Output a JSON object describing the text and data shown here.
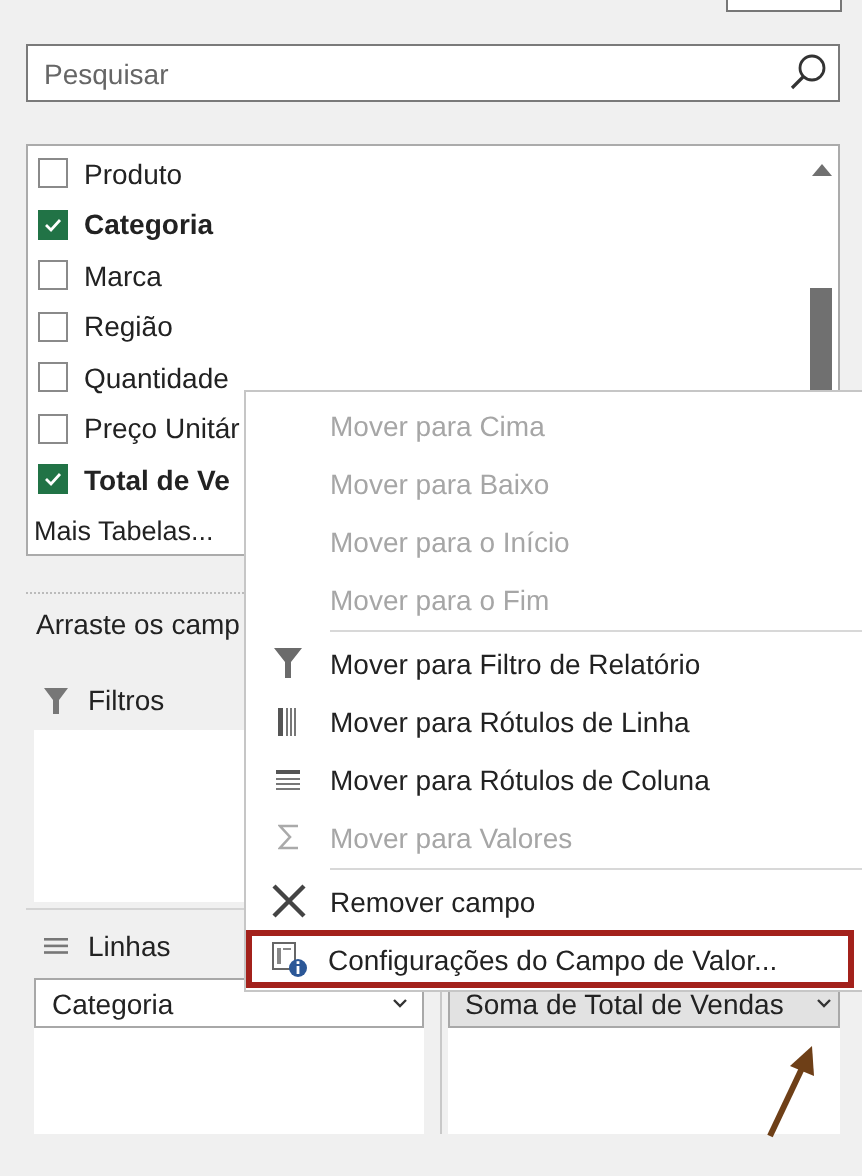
{
  "search": {
    "placeholder": "Pesquisar"
  },
  "fields": [
    {
      "label": "Produto",
      "checked": false
    },
    {
      "label": "Categoria",
      "checked": true
    },
    {
      "label": "Marca",
      "checked": false
    },
    {
      "label": "Região",
      "checked": false
    },
    {
      "label": "Quantidade",
      "checked": false
    },
    {
      "label": "Preço Unitár",
      "checked": false
    },
    {
      "label": "Total de Ve",
      "checked": true
    }
  ],
  "more_tables": "Mais Tabelas...",
  "hint": "Arraste os camp",
  "areas": {
    "filters": {
      "title": "Filtros"
    },
    "rows": {
      "title": "Linhas",
      "items": [
        "Categoria"
      ]
    },
    "values": {
      "items": [
        "Soma de Total de Vendas"
      ]
    }
  },
  "context_menu": {
    "groups": [
      [
        {
          "label": "Mover para Cima",
          "kind": "plain",
          "disabled": true,
          "highlighted": false
        },
        {
          "label": "Mover para Baixo",
          "kind": "plain",
          "disabled": true,
          "highlighted": false
        },
        {
          "label": "Mover para o Início",
          "kind": "plain",
          "disabled": true,
          "highlighted": false
        },
        {
          "label": "Mover para o Fim",
          "kind": "plain",
          "disabled": true,
          "highlighted": false
        }
      ],
      [
        {
          "label": "Mover para Filtro de Relatório",
          "kind": "filter",
          "disabled": false,
          "highlighted": false
        },
        {
          "label": "Mover para Rótulos de Linha",
          "kind": "rows",
          "disabled": false,
          "highlighted": false
        },
        {
          "label": "Mover para Rótulos de Coluna",
          "kind": "columns",
          "disabled": false,
          "highlighted": false
        },
        {
          "label": "Mover para Valores",
          "kind": "sum",
          "disabled": true,
          "highlighted": false
        }
      ],
      [
        {
          "label": "Remover campo",
          "kind": "remove",
          "disabled": false,
          "highlighted": false
        },
        {
          "label": "Configurações do Campo de Valor...",
          "kind": "settings",
          "disabled": false,
          "highlighted": true
        }
      ]
    ]
  },
  "annotation": {
    "arrow": true
  }
}
